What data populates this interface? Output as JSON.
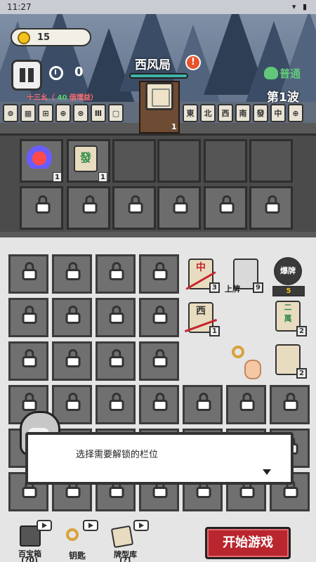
{
  "status": {
    "time": "11:27",
    "icons": "▾ ▮"
  },
  "header": {
    "coins": "15",
    "timer": "0",
    "hand_name": "十三幺（",
    "hand_points": "40",
    "hand_suffix": "倍增益）",
    "round_title": "西风局",
    "alert": "!",
    "difficulty": "普通",
    "wave": "第1波",
    "pedestal_count": "1"
  },
  "left_tiles": [
    "⊚",
    "▦",
    "⊞",
    "⊕",
    "⊗",
    "Ⅲ",
    "▢"
  ],
  "right_tiles": [
    "東",
    "北",
    "西",
    "南",
    "發",
    "中",
    "⊕"
  ],
  "inventory": {
    "item1_count": "1",
    "item2_tile": "發",
    "item2_count": "1"
  },
  "board": {
    "tile_zhong": "中",
    "tile_zhong_count": "3",
    "shangpai_label": "上牌",
    "shangpai_count": "9",
    "explode_label": "爆牌",
    "explode_cost": "5",
    "tile_xi": "西",
    "tile_xi_count": "1",
    "tile_erwan": "二\n萬",
    "tile_erwan_count": "2",
    "tile_back_count": "2"
  },
  "dialog": {
    "text": "选择需要解锁的栏位"
  },
  "bottom": {
    "chest_label": "百宝箱",
    "chest_sub": "(?0)",
    "key_label": "钥匙",
    "deck_label": "牌型库",
    "deck_sub": "(?)",
    "start_label": "开始游戏"
  },
  "colors": {
    "accent_red": "#b9262e",
    "difficulty_green": "#62c77b",
    "coin_gold": "#f4c21c"
  }
}
